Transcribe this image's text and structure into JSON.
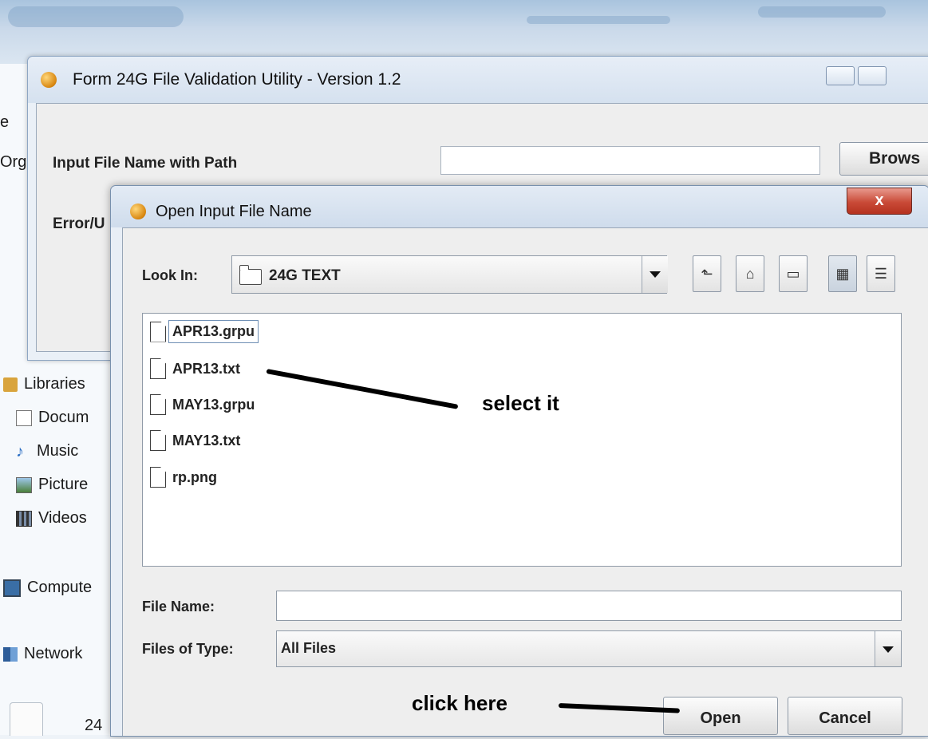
{
  "main_window": {
    "title": "Form 24G File Validation Utility - Version 1.2",
    "input_label": "Input File Name with Path",
    "input_value": "",
    "browse_label": "Brows",
    "error_label": "Error/U"
  },
  "explorer": {
    "partial_labels": [
      "e",
      "Org"
    ],
    "items": [
      {
        "label": "Libraries",
        "icon": "library-icon"
      },
      {
        "label": "Docum",
        "icon": "document-icon"
      },
      {
        "label": "Music",
        "icon": "music-icon"
      },
      {
        "label": "Picture",
        "icon": "picture-icon"
      },
      {
        "label": "Videos",
        "icon": "video-icon"
      },
      {
        "label": "Compute",
        "icon": "computer-icon"
      },
      {
        "label": "Network",
        "icon": "network-icon"
      }
    ],
    "bottom_text": "24"
  },
  "dialog": {
    "title": "Open Input File Name",
    "close_label": "x",
    "look_in_label": "Look In:",
    "look_in_value": "24G TEXT",
    "files": [
      {
        "name": "APR13.grpu"
      },
      {
        "name": "APR13.txt"
      },
      {
        "name": "MAY13.grpu"
      },
      {
        "name": "MAY13.txt"
      },
      {
        "name": "rp.png"
      }
    ],
    "file_name_label": "File Name:",
    "file_name_value": "",
    "files_of_type_label": "Files of Type:",
    "files_of_type_value": "All Files",
    "open_label": "Open",
    "cancel_label": "Cancel"
  },
  "annotations": {
    "select": "select it",
    "click": "click here"
  },
  "colors": {
    "close_button": "#c94a37",
    "dialog_bg": "#eeeeee",
    "titlebar": "#d5e1ef"
  }
}
